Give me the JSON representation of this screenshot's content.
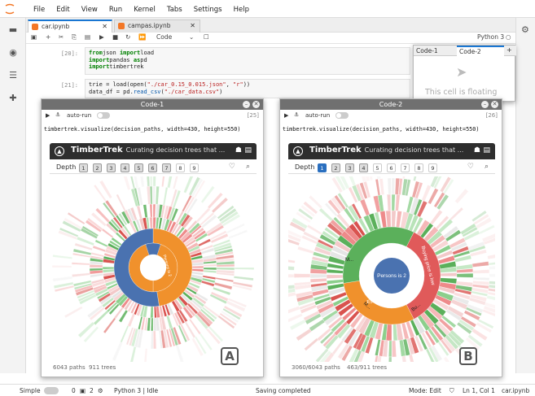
{
  "menubar": {
    "items": [
      "File",
      "Edit",
      "View",
      "Run",
      "Kernel",
      "Tabs",
      "Settings",
      "Help"
    ]
  },
  "tabs": [
    {
      "label": "car.ipynb",
      "active": true
    },
    {
      "label": "campas.ipynb",
      "active": false
    }
  ],
  "toolbar": {
    "cell_type": "Code",
    "kernel": "Python 3"
  },
  "cells": [
    {
      "prompt": "[20]:",
      "lines": [
        [
          [
            "kw",
            "from"
          ],
          [
            "",
            "json "
          ],
          [
            "kw",
            "import"
          ],
          [
            "",
            "load"
          ]
        ],
        [
          [
            "kw",
            "import"
          ],
          [
            "",
            "pandas "
          ],
          [
            "kw",
            "as"
          ],
          [
            "",
            "pd"
          ]
        ],
        [
          [
            "kw",
            "import"
          ],
          [
            "",
            "timbertrek"
          ]
        ]
      ]
    },
    {
      "prompt": "[21]:",
      "lines": [
        [
          [
            "",
            "trie = load(open("
          ],
          [
            "st",
            "\"./car_0.15_0.015.json\""
          ],
          [
            "",
            ", "
          ],
          [
            "st",
            "\"r\""
          ],
          [
            "",
            "))"
          ]
        ],
        [
          [
            "",
            "data_df = pd."
          ],
          [
            "fn",
            "read_csv"
          ],
          [
            "",
            "("
          ],
          [
            "st",
            "\"./car_data.csv\""
          ],
          [
            "",
            ")"
          ]
        ]
      ]
    }
  ],
  "mini_panel": {
    "tab1": "Code-1",
    "tab2": "Code-2",
    "add": "+",
    "floating_text": "This cell is floating"
  },
  "panel_a": {
    "title": "Code-1",
    "autorun_label": "auto-run",
    "count": "[25]",
    "code": "timbertrek.visualize(decision_paths, width=430, height=550)",
    "app_title": "TimberTrek",
    "app_subtitle": "Curating decision trees that ...",
    "depth_label": "Depth",
    "depths": [
      "1",
      "2",
      "3",
      "4",
      "5",
      "6",
      "7",
      "8",
      "9"
    ],
    "selected_depth": "",
    "footer_paths": "6043 paths",
    "footer_trees": "911 trees",
    "letter": "A",
    "center_label": "Persons is 2"
  },
  "panel_b": {
    "title": "Code-2",
    "autorun_label": "auto-run",
    "count": "[26]",
    "code": "timbertrek.visualize(decision_paths, width=430, height=550)",
    "app_title": "TimberTrek",
    "app_subtitle": "Curating decision trees that ...",
    "depth_label": "Depth",
    "depths": [
      "1",
      "2",
      "3",
      "4",
      "5",
      "6",
      "7",
      "8",
      "9"
    ],
    "selected_depth": "1",
    "footer_paths": "3060/6043 paths",
    "footer_trees": "463/911 trees",
    "letter": "B",
    "center_label": "Persons is 2",
    "ring_labels": [
      "Estimated safety is low",
      "Buying price is low",
      "M...",
      "M...",
      "Bu..."
    ]
  },
  "status": {
    "mode_simple": "Simple",
    "count1": "0",
    "count2": "2",
    "kernel": "Python 3 | Idle",
    "saving": "Saving completed",
    "mode": "Mode: Edit",
    "cursor": "Ln 1, Col 1",
    "file": "car.ipynb"
  },
  "colors": {
    "accent": "#1976d2",
    "orange": "#f0912c",
    "blue": "#4a72b0",
    "green": "#6cbf6c",
    "red": "#e05a5a"
  }
}
